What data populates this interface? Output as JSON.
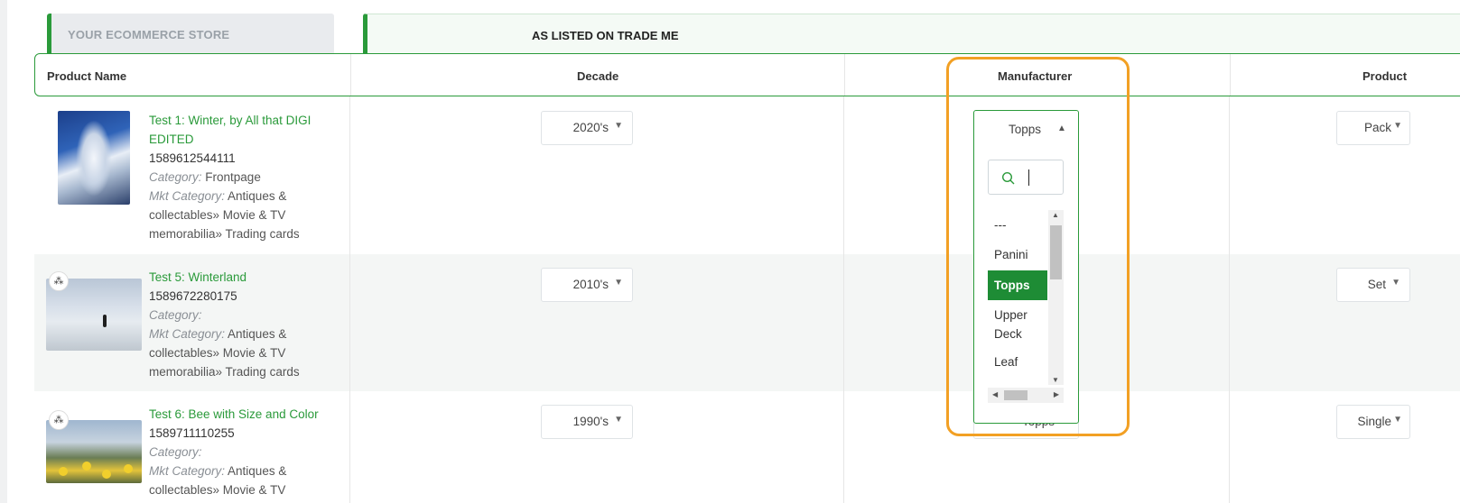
{
  "tabs": {
    "store": "YOUR ECOMMERCE STORE",
    "trademe": "AS LISTED ON TRADE ME"
  },
  "headers": {
    "product_name": "Product Name",
    "decade": "Decade",
    "manufacturer": "Manufacturer",
    "product": "Product"
  },
  "rows": [
    {
      "title_lines": [
        "Test 1: Winter, by All that DIGI",
        "EDITED"
      ],
      "sku": "1589612544111",
      "category_label": "Category:",
      "category_value": " Frontpage",
      "mkt_label": "Mkt Category:",
      "mkt_lines": [
        " Antiques &",
        "collectables» Movie & TV",
        "memorabilia» Trading cards"
      ],
      "decade": "2020's",
      "manufacturer": "Topps",
      "product": "Pack"
    },
    {
      "title_lines": [
        "Test 5: Winterland"
      ],
      "sku": "1589672280175",
      "category_label": "Category:",
      "category_value": "",
      "mkt_label": "Mkt Category:",
      "mkt_lines": [
        " Antiques &",
        "collectables» Movie & TV",
        "memorabilia» Trading cards"
      ],
      "decade": "2010's",
      "manufacturer": "",
      "product": "Set"
    },
    {
      "title_lines": [
        "Test 6: Bee with Size and Color"
      ],
      "sku": "1589711110255",
      "category_label": "Category:",
      "category_value": "",
      "mkt_label": "Mkt Category:",
      "mkt_lines": [
        " Antiques &",
        "collectables» Movie & TV"
      ],
      "decade": "1990's",
      "manufacturer": "Topps",
      "product": "Single"
    }
  ],
  "manufacturer_dropdown": {
    "current": "Topps",
    "search_value": "",
    "options": [
      "---",
      "Panini",
      "Topps",
      "Upper Deck",
      "Leaf"
    ],
    "selected_option": "Topps"
  },
  "icons": {
    "caret_down": "▼",
    "caret_up": "▲",
    "variant_badge": "⁂",
    "search": "search-icon"
  },
  "colors": {
    "accent_green": "#2a9a3a",
    "selected_option": "#1e8c35",
    "highlight_frame": "#f2a024"
  }
}
